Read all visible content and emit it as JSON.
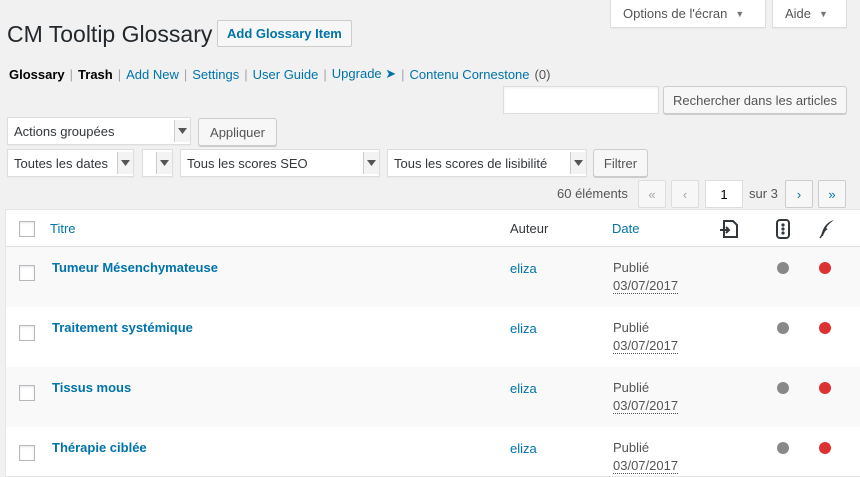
{
  "screen_meta": {
    "screen_options": "Options de l'écran",
    "help": "Aide"
  },
  "header": {
    "title": "CM Tooltip Glossary",
    "add_button": "Add Glossary Item"
  },
  "subnav": {
    "glossary": "Glossary",
    "trash": "Trash",
    "add_new": "Add New",
    "settings": "Settings",
    "user_guide": "User Guide",
    "upgrade": "Upgrade ➤",
    "cornerstone": "Contenu Cornestone",
    "cornerstone_count": "(0)",
    "separator": "|"
  },
  "search": {
    "value": "",
    "button": "Rechercher dans les articles"
  },
  "bulk": {
    "selected": "Actions groupées",
    "apply": "Appliquer"
  },
  "filters": {
    "dates": "Toutes les dates",
    "blank": "",
    "seo": "Tous les scores SEO",
    "readability": "Tous les scores de lisibilité",
    "filter_button": "Filtrer"
  },
  "pagination": {
    "count": "60 éléments",
    "first": "«",
    "prev": "‹",
    "current": "1",
    "of_total": "sur 3",
    "next": "›",
    "last": "»"
  },
  "table": {
    "columns": {
      "title": "Titre",
      "author": "Auteur",
      "date": "Date"
    },
    "rows": [
      {
        "title": "Tumeur Mésenchymateuse",
        "author": "eliza",
        "status": "Publié",
        "date": "03/07/2017",
        "seo": "#888888",
        "readability": "#dc3232"
      },
      {
        "title": "Traitement systémique",
        "author": "eliza",
        "status": "Publié",
        "date": "03/07/2017",
        "seo": "#888888",
        "readability": "#dc3232"
      },
      {
        "title": "Tissus mous",
        "author": "eliza",
        "status": "Publié",
        "date": "03/07/2017",
        "seo": "#888888",
        "readability": "#dc3232"
      },
      {
        "title": "Thérapie ciblée",
        "author": "eliza",
        "status": "Publié",
        "date": "03/07/2017",
        "seo": "#888888",
        "readability": "#dc3232"
      }
    ]
  },
  "colors": {
    "link": "#0073aa",
    "text": "#23282d",
    "bg": "#f1f1f1"
  }
}
